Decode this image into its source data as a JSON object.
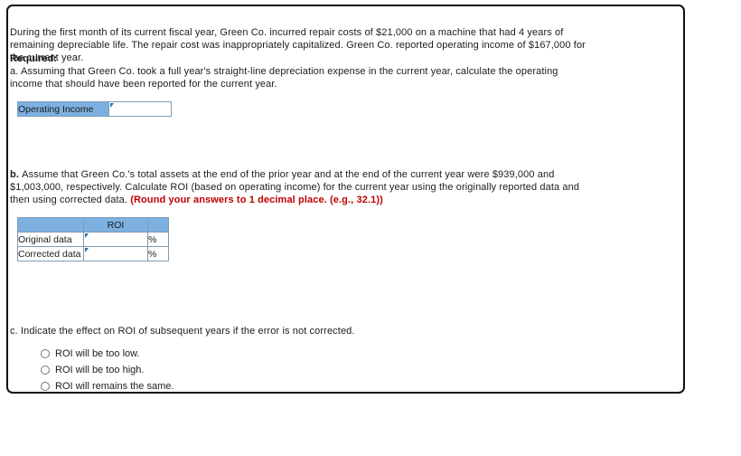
{
  "question": {
    "intro": "During the first month of its current fiscal year, Green Co. incurred repair costs of $21,000 on a machine that had 4 years of remaining depreciable life. The repair cost was inappropriately capitalized. Green Co. reported operating income of $167,000 for the current year.",
    "required_label": "Required:",
    "part_a": "a. Assuming that Green Co. took a full year's straight-line depreciation expense in the current year, calculate the operating income that should have been reported for the current year.",
    "part_b_label": "b. ",
    "part_b": "Assume that Green Co.'s total assets at the end of the prior year and at the end of the current year were $939,000 and $1,003,000, respectively. Calculate ROI (based on operating income) for the current year using the originally reported data and then using corrected data. ",
    "part_b_note": "(Round your answers to 1 decimal place. (e.g., 32.1))",
    "part_c": "c. Indicate the effect on ROI of subsequent years if the error is not corrected."
  },
  "operating_income_table": {
    "label": "Operating Income",
    "value": ""
  },
  "roi_table": {
    "header": [
      "",
      "ROI",
      ""
    ],
    "rows": [
      {
        "label": "Original data",
        "value": "",
        "unit": "%"
      },
      {
        "label": "Corrected data",
        "value": "",
        "unit": "%"
      }
    ]
  },
  "choices": [
    {
      "label": "ROI will be too low.",
      "selected": false
    },
    {
      "label": "ROI will be too high.",
      "selected": false
    },
    {
      "label": "ROI will remains the same.",
      "selected": false
    }
  ],
  "colors": {
    "header_blue": "#7cb0e0",
    "note_red": "#c00000",
    "frame_black": "#111111",
    "grid_blue": "#7f9bb5"
  }
}
